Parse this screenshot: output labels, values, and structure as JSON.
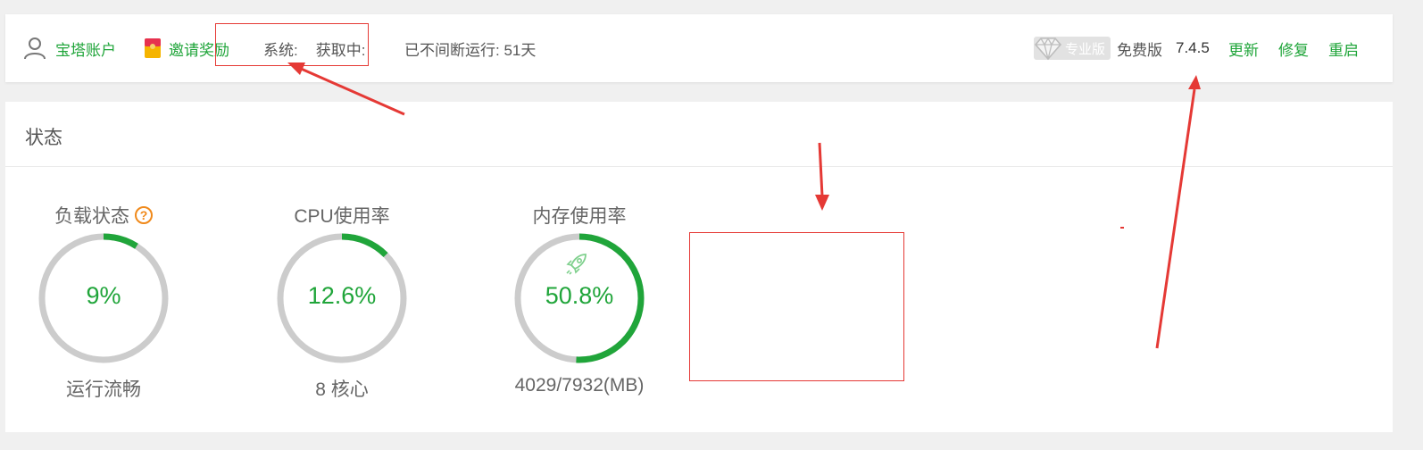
{
  "topbar": {
    "account_label": "宝塔账户",
    "invite_label": "邀请奖励",
    "system_label": "系统:",
    "system_value": "获取中:",
    "uptime_label": "已不间断运行: 51天",
    "pro_badge": "专业版",
    "edition": "免费版",
    "version": "7.4.5",
    "update_label": "更新",
    "repair_label": "修复",
    "restart_label": "重启"
  },
  "status": {
    "title": "状态",
    "gauges": [
      {
        "title": "负载状态",
        "value_text": "9%",
        "fraction": 0.09,
        "subtitle": "运行流畅"
      },
      {
        "title": "CPU使用率",
        "value_text": "12.6%",
        "fraction": 0.126,
        "subtitle": "8 核心"
      },
      {
        "title": "内存使用率",
        "value_text": "50.8%",
        "fraction": 0.508,
        "subtitle": "4029/7932(MB)"
      }
    ]
  },
  "colors": {
    "accent": "#20a53a",
    "ring_track": "#cccccc",
    "annotation": "#e53935",
    "help": "#f0891a"
  }
}
